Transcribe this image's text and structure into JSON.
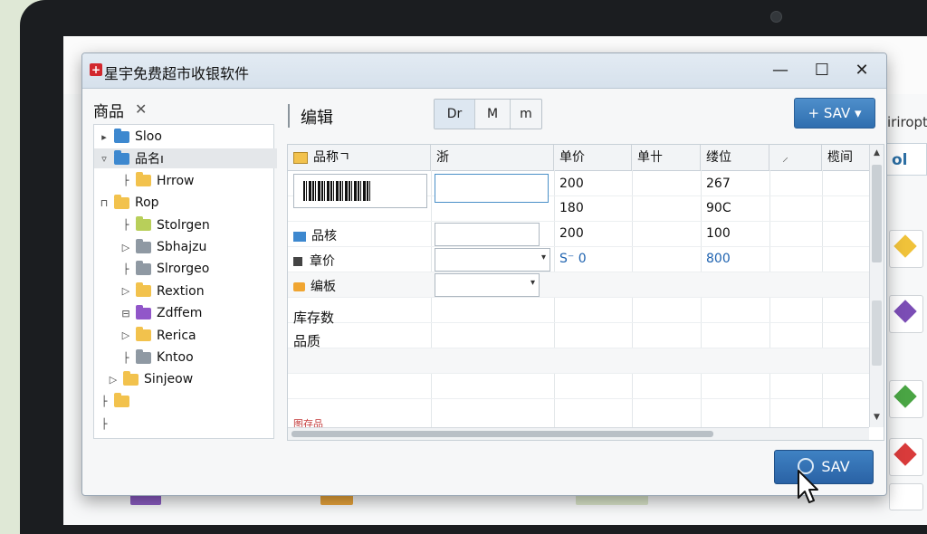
{
  "window": {
    "title": "星宇免费超市收银软件",
    "controls": {
      "minimize": "—",
      "maximize": "☐",
      "close": "✕"
    }
  },
  "background": {
    "right_text": "iriroptr",
    "tab_label": "ol"
  },
  "tree": {
    "header": "商品",
    "close_glyph": "✕",
    "items": [
      {
        "label": "Sloo",
        "twisty": "▸",
        "color": "#3d88cf"
      },
      {
        "label": "品名ı",
        "twisty": "▿",
        "color": "#3d88cf",
        "selected": true
      },
      {
        "label": "Hrrow",
        "twisty": "├",
        "color": "#f2c24d"
      },
      {
        "label": "Rop",
        "twisty": "⊓",
        "color": "#f2c24d"
      },
      {
        "label": "Stolrgen",
        "twisty": "├",
        "color": "#b8cf5a"
      },
      {
        "label": "Sbhajzu",
        "twisty": "▷",
        "color": "#8f99a3"
      },
      {
        "label": "Slrorgeo",
        "twisty": "├",
        "color": "#8f99a3"
      },
      {
        "label": "Rextion",
        "twisty": "▷",
        "color": "#f2c24d"
      },
      {
        "label": "Zdffem",
        "twisty": "⊟",
        "color": "#9156c9"
      },
      {
        "label": "Rerica",
        "twisty": "▷",
        "color": "#f2c24d"
      },
      {
        "label": "Kntoo",
        "twisty": "├",
        "color": "#8f99a3"
      },
      {
        "label": "Sinjeow",
        "twisty": "▷",
        "color": "#f2c24d"
      },
      {
        "label": "",
        "twisty": "├",
        "color": "#f2c24d"
      },
      {
        "label": "",
        "twisty": "├",
        "color": "none"
      }
    ]
  },
  "toolbar": {
    "edit_label": "编辑",
    "segments": [
      "Dr",
      "M",
      "m"
    ],
    "save_label": "+ SAV ▾"
  },
  "grid": {
    "columns": [
      "品称ㄱ",
      "浙",
      "单价",
      "单卄",
      "缕位",
      "⸝",
      "榄间"
    ],
    "rows": [
      {
        "label": "",
        "price": "200",
        "unit": "267"
      },
      {
        "label": "",
        "price": "180",
        "unit": "90C"
      },
      {
        "label": "品核",
        "price": "200",
        "unit": "100"
      },
      {
        "label": "章价",
        "price": "S⁻ 0",
        "unit": "800"
      },
      {
        "label": "编板",
        "price": "",
        "unit": ""
      },
      {
        "label": "库存数",
        "price": "",
        "unit": ""
      },
      {
        "label": "品质",
        "price": "",
        "unit": ""
      }
    ],
    "dropdown_arrow": "▾",
    "footer_label": "图存品"
  },
  "footer": {
    "save_label": "SAV"
  }
}
